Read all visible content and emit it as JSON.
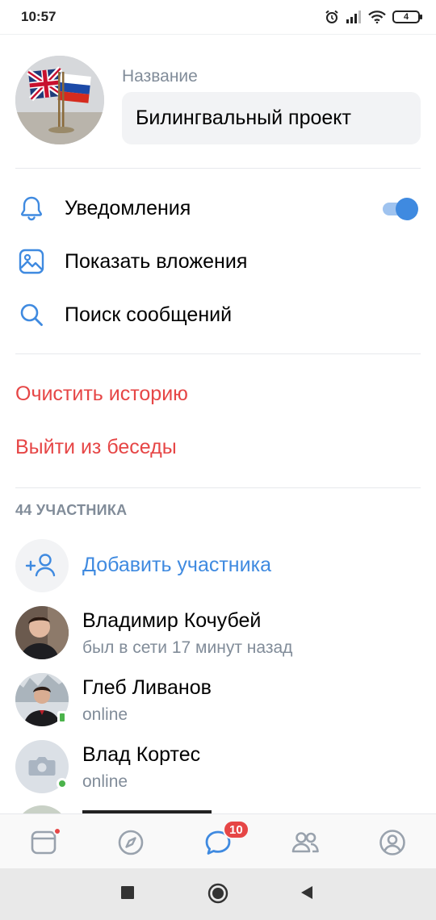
{
  "status_bar": {
    "time": "10:57",
    "battery": "4"
  },
  "chat": {
    "name_label": "Название",
    "name_value": "Билингвальный проект"
  },
  "settings": {
    "notifications_label": "Уведомления",
    "notifications_on": true,
    "attachments_label": "Показать вложения",
    "search_label": "Поиск сообщений"
  },
  "actions": {
    "clear_history": "Очистить историю",
    "leave_chat": "Выйти из беседы"
  },
  "members": {
    "section_title": "44 УЧАСТНИКА",
    "add_label": "Добавить участника",
    "list": [
      {
        "name": "Владимир Кочубей",
        "status": "был в сети 17 минут назад",
        "online": "none"
      },
      {
        "name": "Глеб Ливанов",
        "status": "online",
        "online": "mobile"
      },
      {
        "name": "Влад Кортес",
        "status": "online",
        "online": "web"
      }
    ]
  },
  "tabbar": {
    "items": [
      {
        "icon": "news-icon",
        "badge": "dot"
      },
      {
        "icon": "compass-icon"
      },
      {
        "icon": "messages-icon",
        "badge_count": "10"
      },
      {
        "icon": "friends-icon"
      },
      {
        "icon": "profile-icon"
      }
    ],
    "accent": "#3f8ae0",
    "badge_color": "#e64646"
  },
  "colors": {
    "accent": "#3f8ae0",
    "danger": "#e64646",
    "secondary": "#818c99"
  }
}
